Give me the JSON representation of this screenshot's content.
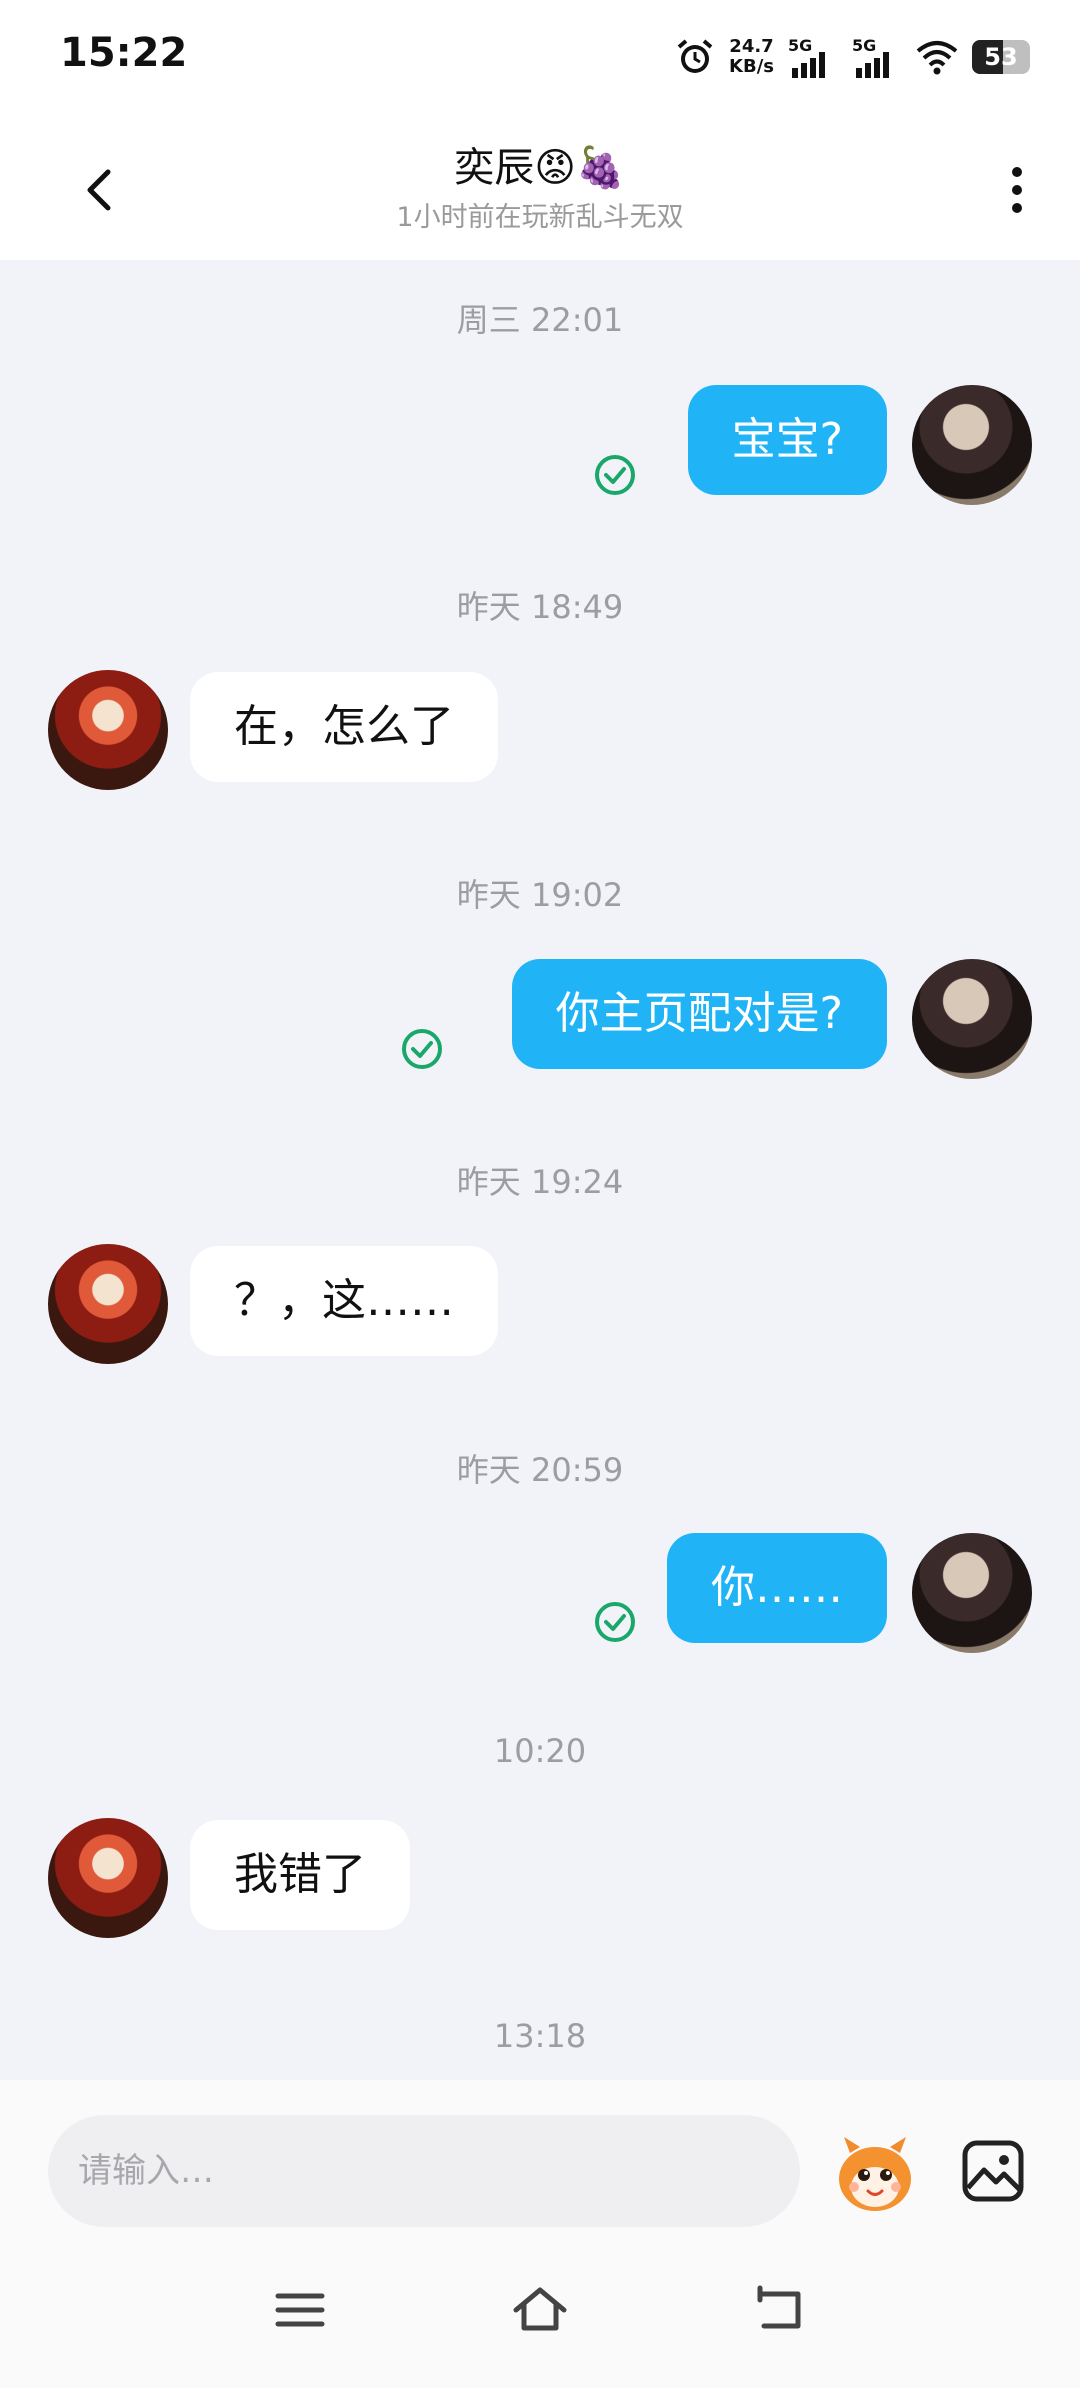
{
  "status_bar": {
    "time": "15:22",
    "net_speed_value": "24.7",
    "net_speed_unit": "KB/s",
    "sim1_label": "5G",
    "sim2_label": "5G",
    "battery_percent": "53"
  },
  "header": {
    "title": "奕辰😡🍇",
    "subtitle": "1小时前在玩新乱斗无双"
  },
  "messages": [
    {
      "timestamp": "周三 22:01",
      "direction": "out",
      "text": "宝宝?",
      "read": true
    },
    {
      "timestamp": "昨天 18:49",
      "direction": "in",
      "text": "在，怎么了"
    },
    {
      "timestamp": "昨天 19:02",
      "direction": "out",
      "text": "你主页配对是?",
      "read": true
    },
    {
      "timestamp": "昨天 19:24",
      "direction": "in",
      "text": "？，这……"
    },
    {
      "timestamp": "昨天 20:59",
      "direction": "out",
      "text": "你……",
      "read": true
    },
    {
      "timestamp": "10:20",
      "direction": "in",
      "text": "我错了"
    },
    {
      "timestamp": "13:18"
    }
  ],
  "composer": {
    "placeholder": "请输入…"
  },
  "colors": {
    "outgoing_bubble": "#20b4f7",
    "incoming_bubble": "#ffffff",
    "read_check": "#1aa86a",
    "chat_background": "#f1f3f8"
  },
  "icons": [
    "back-arrow-icon",
    "more-vertical-icon",
    "read-check-icon",
    "mascot-sticker-icon",
    "image-gallery-icon",
    "menu-icon",
    "home-icon",
    "back-nav-icon"
  ]
}
